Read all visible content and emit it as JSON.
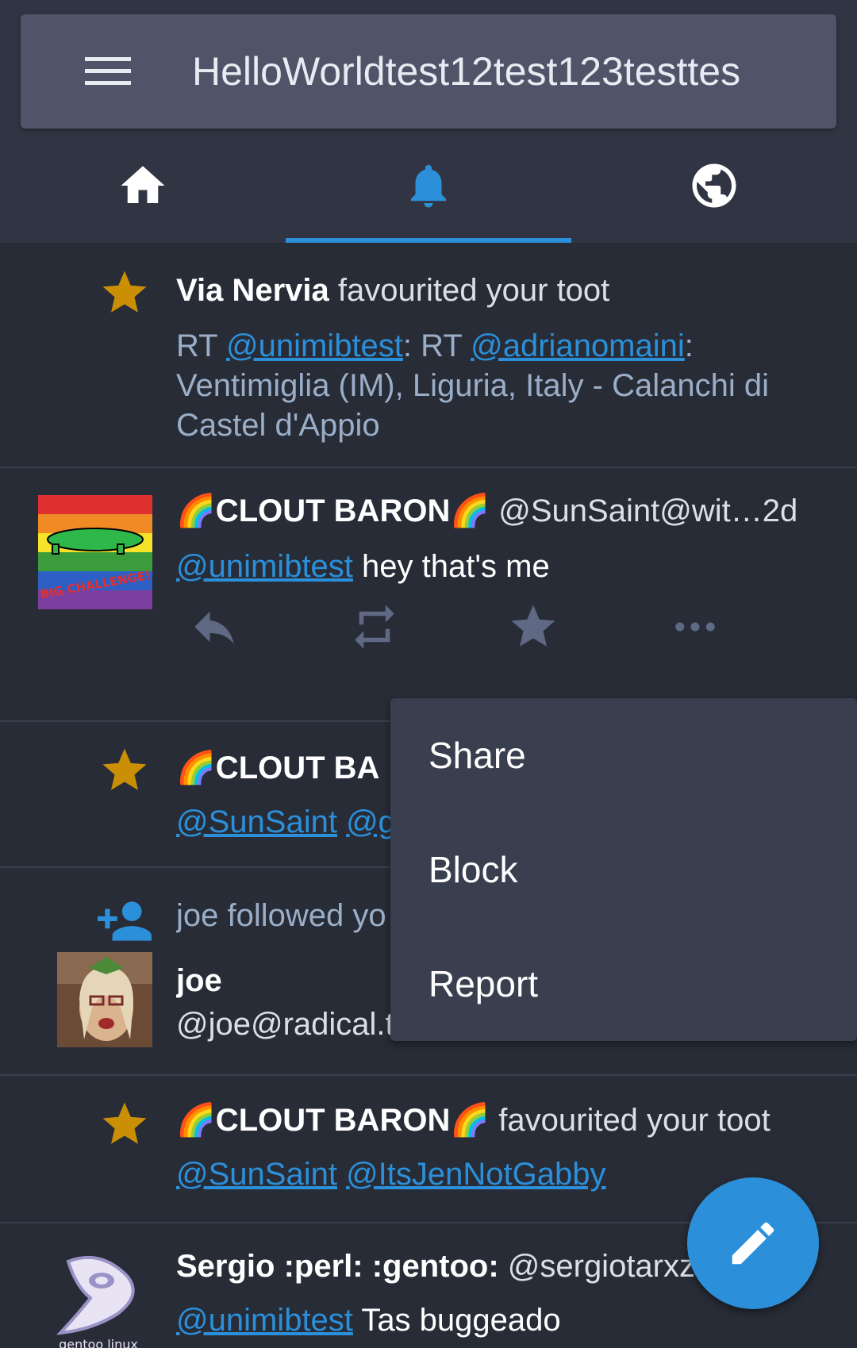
{
  "header": {
    "title": "HelloWorldtest12test123testtes"
  },
  "tabs": [
    {
      "name": "home",
      "icon": "home-icon"
    },
    {
      "name": "notifications",
      "icon": "bell-icon",
      "active": true
    },
    {
      "name": "federated",
      "icon": "globe-icon"
    }
  ],
  "notifications": {
    "n1": {
      "actor": "Via Nervia",
      "action": "favourited your toot",
      "rt1": "RT ",
      "mention1": "@unimibtest",
      "rt2": ": RT ",
      "mention2": "@adrianomaini",
      "rest": ": Ventimiglia (IM), Liguria, Italy - Calanchi di Castel d'Appio"
    },
    "n2": {
      "name": "🌈CLOUT BARON🌈",
      "handle": "@SunSaint@wit…",
      "time": "2d",
      "mention": "@unimibtest",
      "text": "hey that's me",
      "avatar_text": "BIG CHALLENGE!"
    },
    "n3": {
      "name": "🌈CLOUT BA",
      "mention1": "@SunSaint",
      "mention2": "@g"
    },
    "n4": {
      "text": "joe followed yo",
      "name": "joe",
      "handle": "@joe@radical.t"
    },
    "n5": {
      "name": "🌈CLOUT BARON🌈",
      "action": "favourited your toot",
      "mention1": "@SunSaint",
      "mention2": "@ItsJenNotGabby"
    },
    "n6": {
      "name": "Sergio :perl: :gentoo:",
      "handle": "@sergiotarxz",
      "mention": "@unimibtest",
      "text": "Tas buggeado",
      "avatar_caption": "gentoo linux"
    }
  },
  "context_menu": {
    "items": [
      "Share",
      "Block",
      "Report"
    ]
  },
  "colors": {
    "accent": "#2b90d9",
    "favourite": "#ca8f04",
    "background": "#282c37",
    "header": "#4f5468"
  }
}
